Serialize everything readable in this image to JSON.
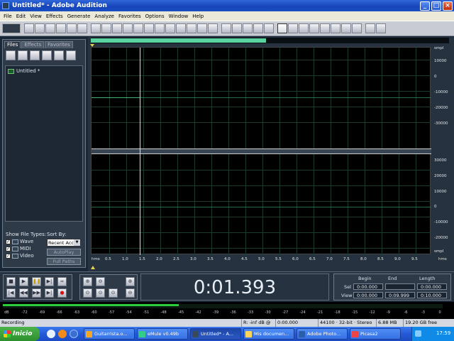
{
  "window": {
    "title": "Untitled* - Adobe Audition"
  },
  "menu": [
    "File",
    "Edit",
    "View",
    "Effects",
    "Generate",
    "Analyze",
    "Favorites",
    "Options",
    "Window",
    "Help"
  ],
  "left_panel": {
    "tabs": [
      "Files",
      "Effects",
      "Favorites"
    ],
    "files": [
      "Untitled *"
    ],
    "show_file_types_label": "Show File Types:",
    "types": [
      "Wave",
      "MIDI",
      "Video"
    ],
    "sort_by_label": "Sort By:",
    "sort_value": "Recent Acc",
    "autoplay_label": "AutoPlay",
    "fullpaths_label": "Full Paths"
  },
  "editor": {
    "right_ruler_top": [
      "smpl",
      "10000",
      "0",
      "-10000",
      "-20000",
      "-30000"
    ],
    "right_ruler_bottom": [
      "30000",
      "20000",
      "10000",
      "0",
      "-10000",
      "-20000",
      "smpl"
    ],
    "bottom_ruler_start": "hms",
    "bottom_ruler_end": "hms",
    "time_ticks": [
      "0.5",
      "1.0",
      "1.5",
      "2.0",
      "2.5",
      "3.0",
      "3.5",
      "4.0",
      "4.5",
      "5.0",
      "5.5",
      "6.0",
      "6.5",
      "7.0",
      "7.5",
      "8.0",
      "8.5",
      "9.0",
      "9.5"
    ],
    "cursor_time": "0:01.393",
    "visible_fraction": 0.49
  },
  "selview": {
    "col_begin": "Begin",
    "col_end": "End",
    "col_length": "Length",
    "sel_label": "Sel",
    "view_label": "View",
    "sel_begin": "0:00.000",
    "sel_end": "",
    "sel_length": "0:00.000",
    "view_begin": "0:00.000",
    "view_end": "0:09.999",
    "view_length": "0:10.000"
  },
  "meter": {
    "labels": [
      "dB",
      "-72",
      "-69",
      "-66",
      "-63",
      "-60",
      "-57",
      "-54",
      "-51",
      "-48",
      "-45",
      "-42",
      "-39",
      "-36",
      "-33",
      "-30",
      "-27",
      "-24",
      "-21",
      "-18",
      "-15",
      "-12",
      "-9",
      "-6",
      "-3",
      "0"
    ],
    "level_fraction": 0.4
  },
  "status": {
    "mode": "Recording",
    "level": "R: -inf dB @",
    "position": "0:00.000",
    "format": "44100 · 32-bit · Stereo",
    "size": "6.88 MB",
    "free": "19.20 GB free"
  },
  "taskbar": {
    "start_label": "Inicio",
    "tasks": [
      "Guitarrista.o...",
      "eMule v0.49b",
      "Untitled* - A...",
      "Mis documen...",
      "Adobe Photo...",
      "Picasa2"
    ],
    "clock": "17:59"
  },
  "colors": {
    "accent_wave": "#3db86a",
    "overview": "#5ad3a0",
    "meter": "#2ccd3a"
  }
}
